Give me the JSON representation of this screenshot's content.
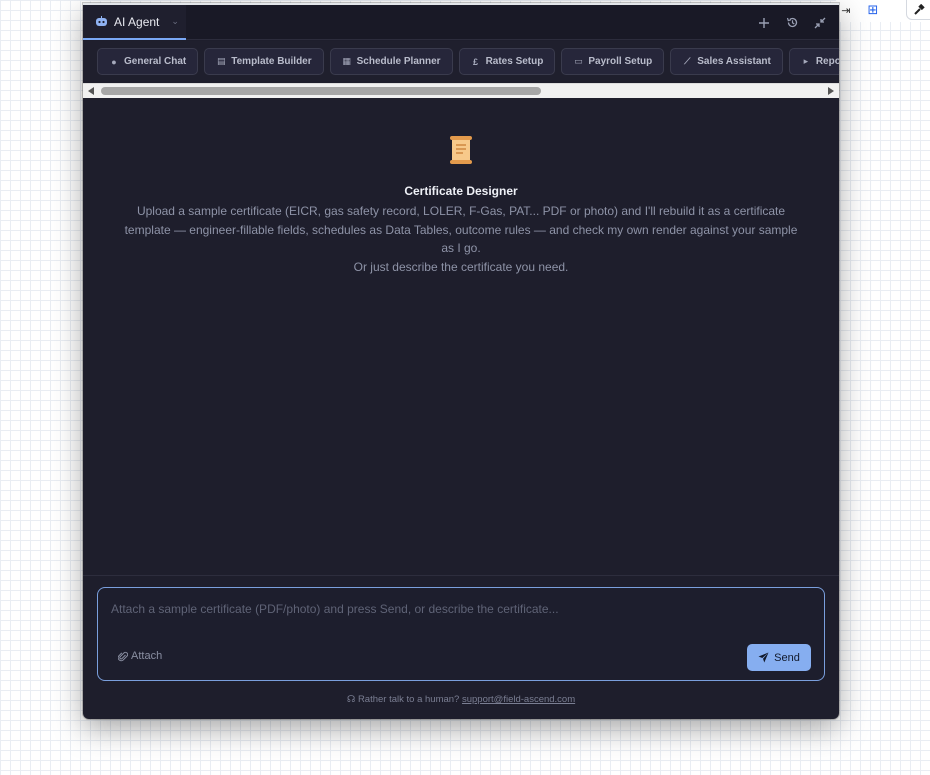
{
  "panel": {
    "tab": {
      "label": "AI Agent",
      "close_icon": "chevron-down-icon"
    },
    "actions": [
      {
        "icon": "plus-icon"
      },
      {
        "icon": "history-icon"
      },
      {
        "icon": "minimize-icon"
      }
    ]
  },
  "chips": [
    {
      "label": "General Chat",
      "icon": "chat-bubble-icon"
    },
    {
      "label": "Template Builder",
      "icon": "clipboard-icon"
    },
    {
      "label": "Schedule Planner",
      "icon": "calendar-icon"
    },
    {
      "label": "Rates Setup",
      "icon": "pound-icon"
    },
    {
      "label": "Payroll Setup",
      "icon": "id-card-icon"
    },
    {
      "label": "Sales Assistant",
      "icon": "chart-line-icon"
    },
    {
      "label": "Reports",
      "icon": "file-export-icon"
    }
  ],
  "empty_state": {
    "title": "Certificate Designer",
    "description": "Upload a sample certificate (EICR, gas safety record, LOLER, F-Gas, PAT... PDF or photo) and I'll rebuild it as a certificate template — engineer-fillable fields, schedules as Data Tables, outcome rules — and check my own render against your sample as I go.",
    "hint": "Or just describe the certificate you need."
  },
  "composer": {
    "placeholder": "Attach a sample certificate (PDF/photo) and press Send, or describe the certificate...",
    "attach_label": "Attach",
    "send_label": "Send"
  },
  "support": {
    "text": "Rather talk to a human?",
    "email": "support@field-ascend.com"
  },
  "colors": {
    "panel_bg": "#1e1e2c",
    "accent": "#86aef0",
    "scroll_icon": "#f0b36a"
  }
}
